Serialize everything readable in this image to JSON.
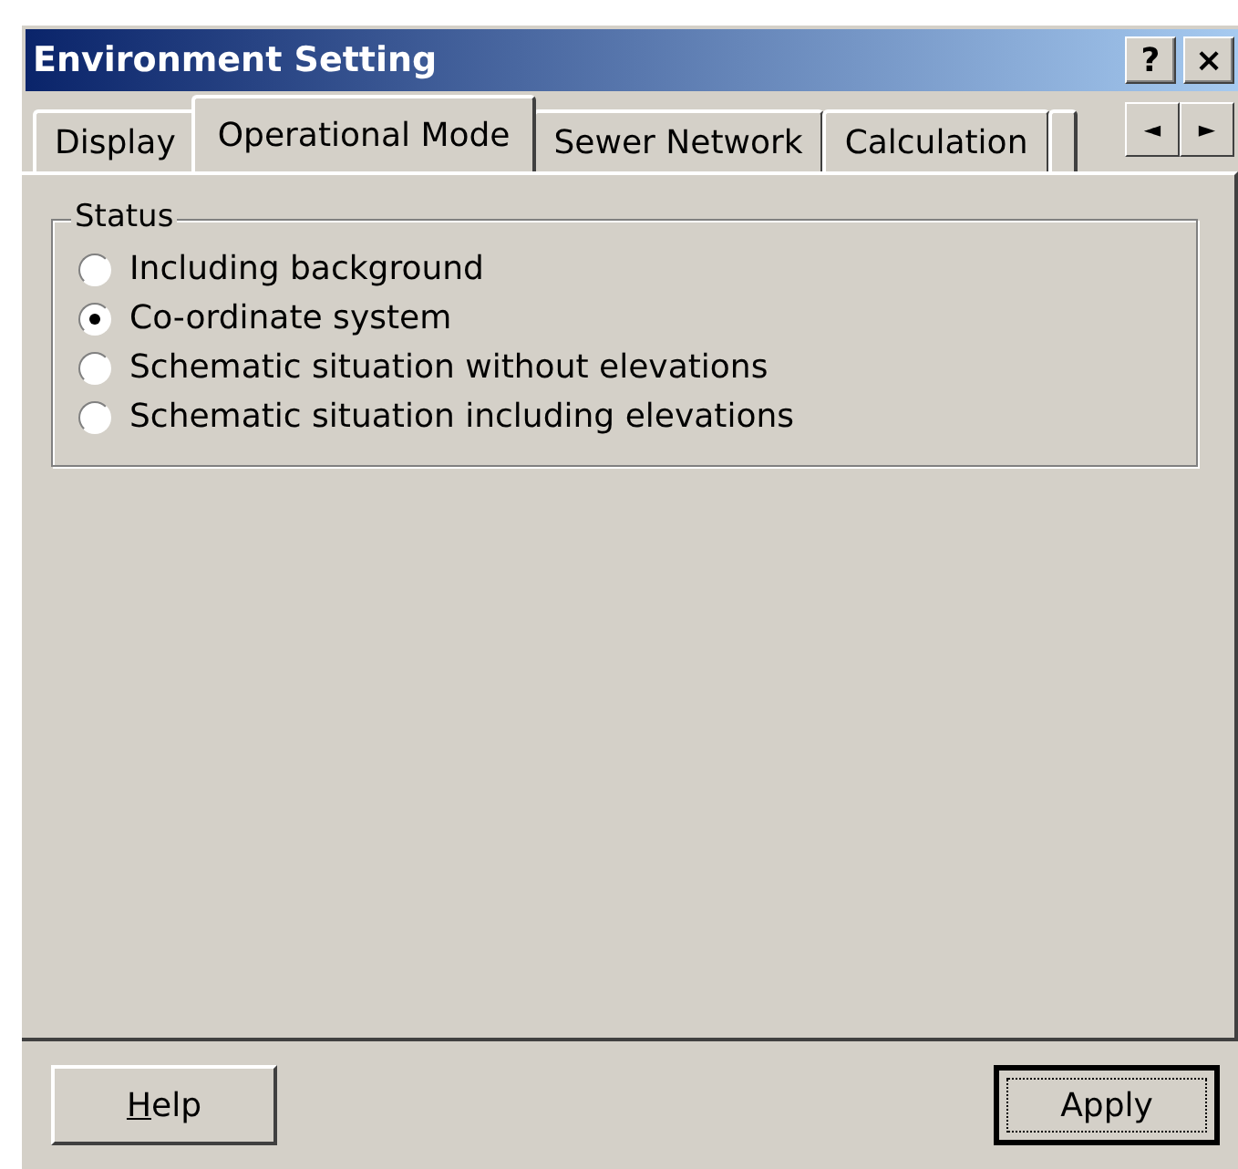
{
  "window": {
    "title": "Environment Setting",
    "title_buttons": [
      "?",
      "×"
    ]
  },
  "tabs": [
    {
      "label": "Display",
      "selected": false
    },
    {
      "label": "Operational Mode",
      "selected": true
    },
    {
      "label": "Sewer Network",
      "selected": false
    },
    {
      "label": "Calculation",
      "selected": false
    }
  ],
  "tab_scroll": [
    "◄",
    "►"
  ],
  "status_group": {
    "title": "Status",
    "options": [
      {
        "label": "Including background",
        "selected": false
      },
      {
        "label": "Co-ordinate system",
        "selected": true
      },
      {
        "label": "Schematic situation without elevations",
        "selected": false
      },
      {
        "label": "Schematic situation including elevations",
        "selected": false
      }
    ]
  },
  "buttons": [
    {
      "label": "Help",
      "underline_first": true,
      "default": false
    },
    {
      "label": "Apply",
      "underline_first": false,
      "default": true
    }
  ]
}
